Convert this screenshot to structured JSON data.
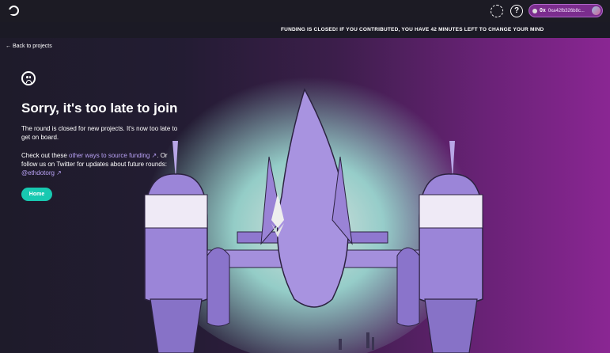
{
  "topbar": {
    "wallet_network": "0x",
    "wallet_address": "0xa42fb326b8c..."
  },
  "banner": {
    "text": "FUNDING IS CLOSED! IF YOU CONTRIBUTED, YOU HAVE 42 MINUTES LEFT TO CHANGE YOUR MIND"
  },
  "nav": {
    "back_label": "Back to projects"
  },
  "main": {
    "title": "Sorry, it's too late to join",
    "para1": "The round is closed for new projects. It's now too late to get on board.",
    "para2_a": "Check out these ",
    "para2_link1": "other ways to source funding",
    "para2_b": ". Or follow us on Twitter for updates about future rounds: ",
    "para2_link2": "@ethdotorg",
    "home_label": "Home"
  },
  "icons": [
    "logo-icon",
    "settings-icon",
    "help-icon",
    "arrow-left-icon",
    "sad-face-icon",
    "external-link-icon"
  ]
}
